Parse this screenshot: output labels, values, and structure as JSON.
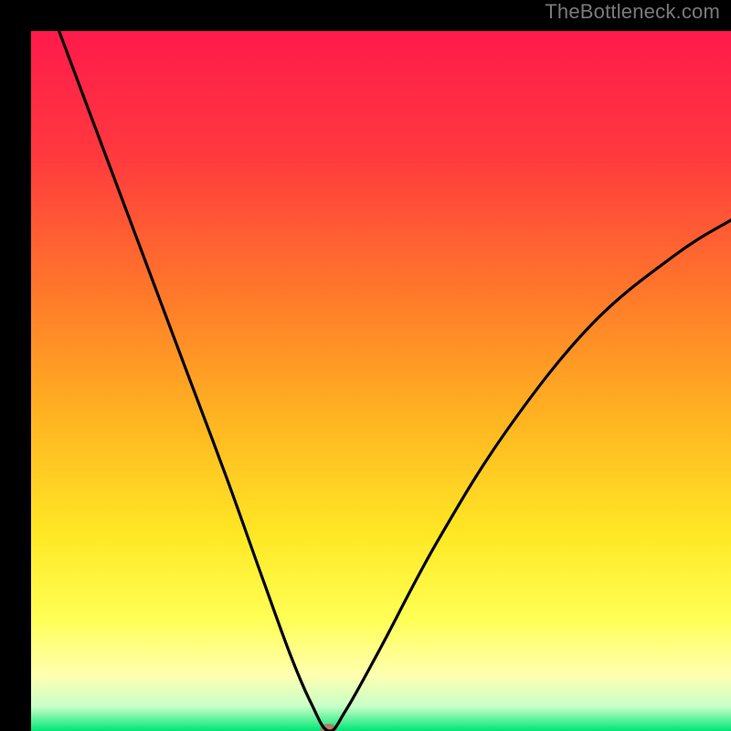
{
  "watermark": {
    "text": "TheBottleneck.com"
  },
  "chart_data": {
    "type": "line",
    "title": "",
    "xlabel": "",
    "ylabel": "",
    "xlim": [
      0,
      100
    ],
    "ylim": [
      0,
      100
    ],
    "background_gradient": {
      "stops": [
        {
          "offset": 0.0,
          "color": "#ff1a4b"
        },
        {
          "offset": 0.18,
          "color": "#ff3a3e"
        },
        {
          "offset": 0.38,
          "color": "#ff7a2a"
        },
        {
          "offset": 0.55,
          "color": "#ffb321"
        },
        {
          "offset": 0.72,
          "color": "#ffe825"
        },
        {
          "offset": 0.84,
          "color": "#ffff55"
        },
        {
          "offset": 0.92,
          "color": "#ffffb0"
        },
        {
          "offset": 0.965,
          "color": "#c8ffc8"
        },
        {
          "offset": 1.0,
          "color": "#00e676"
        }
      ]
    },
    "curve": {
      "comment": "bottleneck-style V curve; y is bottleneck % (0 good, 100 bad)",
      "min_x": 42.5,
      "points": [
        {
          "x": 4,
          "y": 100
        },
        {
          "x": 10,
          "y": 84
        },
        {
          "x": 16,
          "y": 68
        },
        {
          "x": 22,
          "y": 52
        },
        {
          "x": 28,
          "y": 36
        },
        {
          "x": 33,
          "y": 22
        },
        {
          "x": 37,
          "y": 11
        },
        {
          "x": 40,
          "y": 4
        },
        {
          "x": 42.5,
          "y": 0
        },
        {
          "x": 45,
          "y": 3
        },
        {
          "x": 50,
          "y": 12
        },
        {
          "x": 58,
          "y": 27
        },
        {
          "x": 68,
          "y": 43
        },
        {
          "x": 80,
          "y": 58
        },
        {
          "x": 92,
          "y": 68
        },
        {
          "x": 100,
          "y": 73
        }
      ]
    },
    "marker": {
      "x": 42.5,
      "y": 0,
      "rx": 9,
      "ry": 6,
      "fill": "#c07660",
      "opacity": 0.9
    }
  }
}
